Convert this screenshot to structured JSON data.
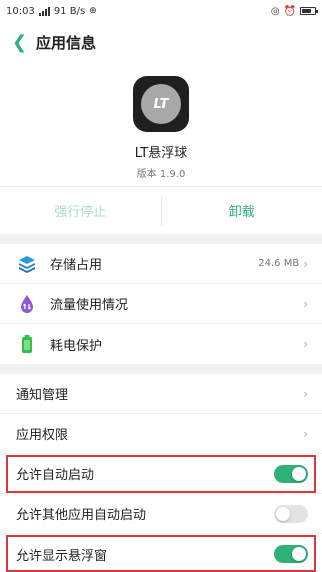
{
  "status_bar": {
    "time": "10:03",
    "net_speed": "91 B/s"
  },
  "header": {
    "title": "应用信息"
  },
  "app": {
    "icon_text": "LT",
    "name": "LT悬浮球",
    "version": "版本 1.9.0"
  },
  "actions": {
    "force_stop": "强行停止",
    "uninstall": "卸载"
  },
  "group1": [
    {
      "label": "存储占用",
      "meta": "24.6 MB",
      "icon": "stack-icon",
      "color": "#2a9ad8"
    },
    {
      "label": "流量使用情况",
      "meta": "",
      "icon": "data-drop-icon",
      "color": "#8d5bd1"
    },
    {
      "label": "耗电保护",
      "meta": "",
      "icon": "battery-icon",
      "color": "#2fbf4b"
    }
  ],
  "group2": [
    {
      "label": "通知管理",
      "type": "nav"
    },
    {
      "label": "应用权限",
      "type": "nav"
    },
    {
      "label": "允许自动启动",
      "type": "toggle",
      "on": true,
      "highlighted": true
    },
    {
      "label": "允许其他应用自动启动",
      "type": "toggle",
      "on": false,
      "highlighted": false
    },
    {
      "label": "允许显示悬浮窗",
      "type": "toggle",
      "on": true,
      "highlighted": true
    }
  ],
  "colors": {
    "accent": "#2db07a",
    "accent_disabled": "#a8dfc6",
    "highlight": "#d9363e"
  }
}
